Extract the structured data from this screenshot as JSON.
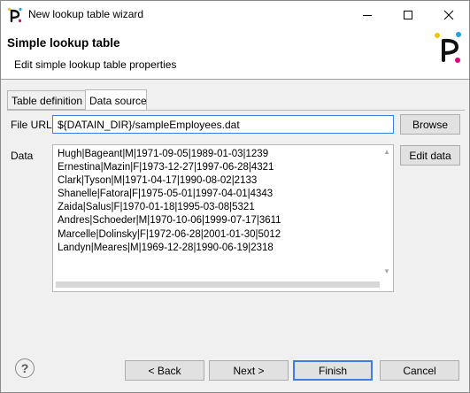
{
  "window": {
    "title": "New lookup table wizard",
    "minimize_icon": "minimize-icon",
    "maximize_icon": "maximize-icon",
    "close_icon": "close-icon"
  },
  "banner": {
    "title": "Simple lookup table",
    "description": "Edit simple lookup table properties",
    "logo_icon": "cloverdx-logo-icon"
  },
  "tabs": [
    {
      "label": "Table definition",
      "selected": false
    },
    {
      "label": "Data source",
      "selected": true
    }
  ],
  "file_url": {
    "label": "File URL",
    "value": "${DATAIN_DIR}/sampleEmployees.dat",
    "browse_label": "Browse"
  },
  "data": {
    "label": "Data",
    "edit_label": "Edit data",
    "lines": [
      "Hugh|Bageant|M|1971-09-05|1989-01-03|1239",
      "Ernestina|Mazin|F|1973-12-27|1997-06-28|4321",
      "Clark|Tyson|M|1971-04-17|1990-08-02|2133",
      "Shanelle|Fatora|F|1975-05-01|1997-04-01|4343",
      "Zaida|Salus|F|1970-01-18|1995-03-08|5321",
      "Andres|Schoeder|M|1970-10-06|1999-07-17|3611",
      "Marcelle|Dolinsky|F|1972-06-28|2001-01-30|5012",
      "Landyn|Meares|M|1969-12-28|1990-06-19|2318"
    ]
  },
  "footer": {
    "help_icon": "help-icon",
    "back_label": "< Back",
    "next_label": "Next >",
    "finish_label": "Finish",
    "cancel_label": "Cancel"
  },
  "colors": {
    "accent": "#3d7ce0",
    "logo_yellow": "#f6c400",
    "logo_blue": "#1aa3e8",
    "logo_pink": "#e2007a"
  }
}
